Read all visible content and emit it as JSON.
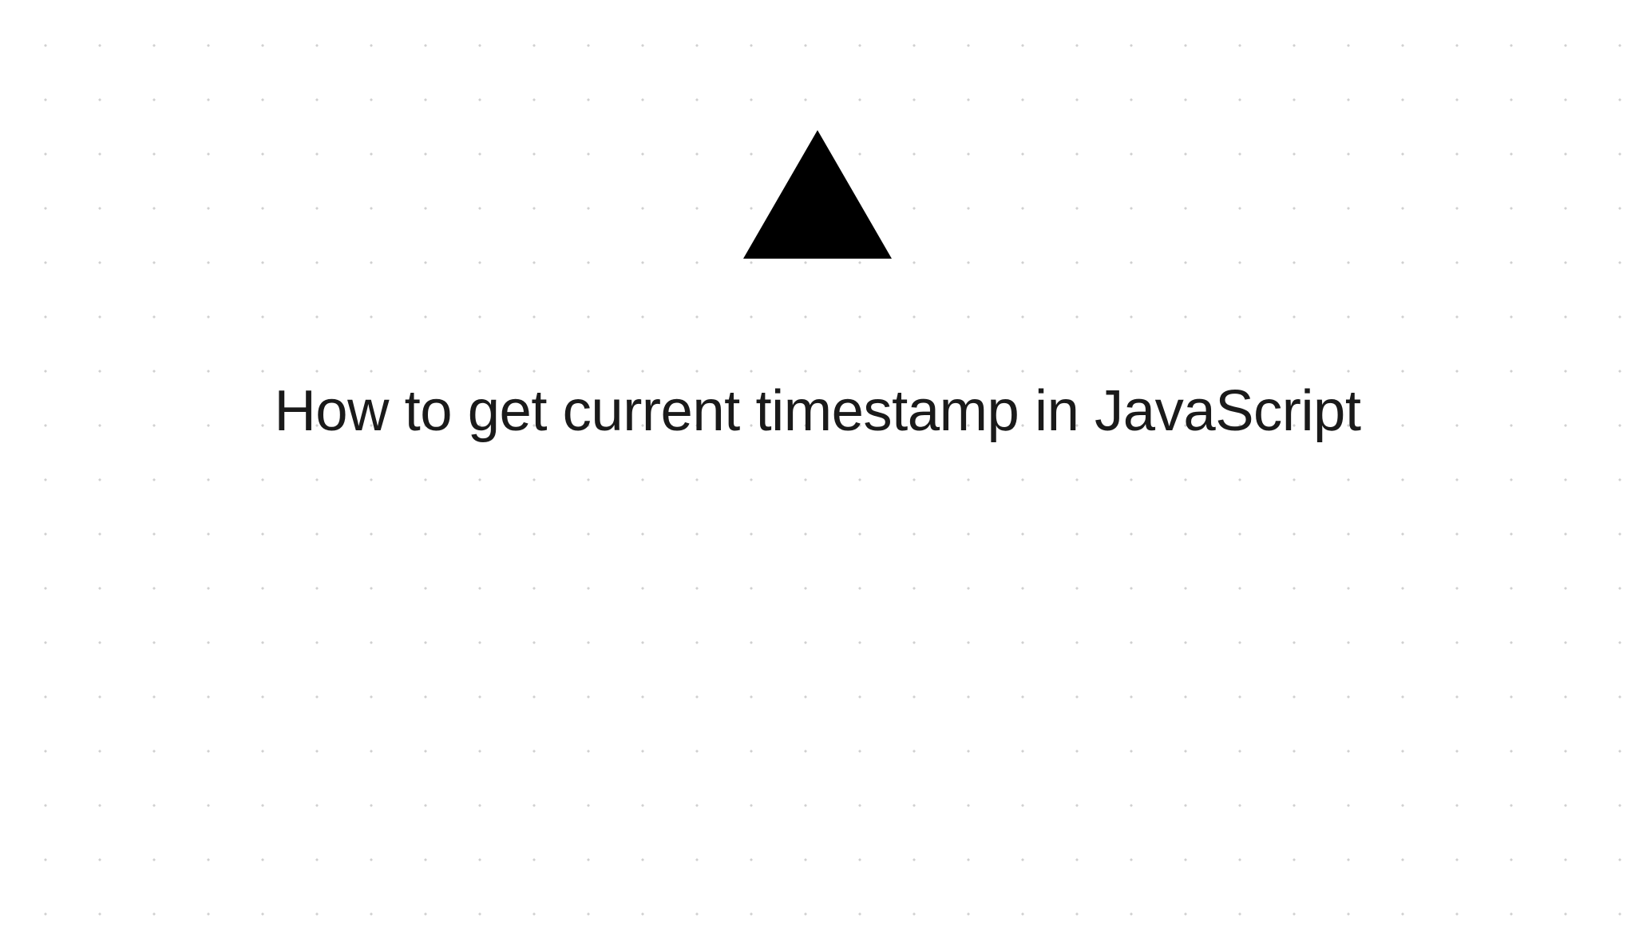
{
  "logo": {
    "name": "triangle-logo",
    "color": "#000000"
  },
  "title": "How to get current timestamp in JavaScript"
}
